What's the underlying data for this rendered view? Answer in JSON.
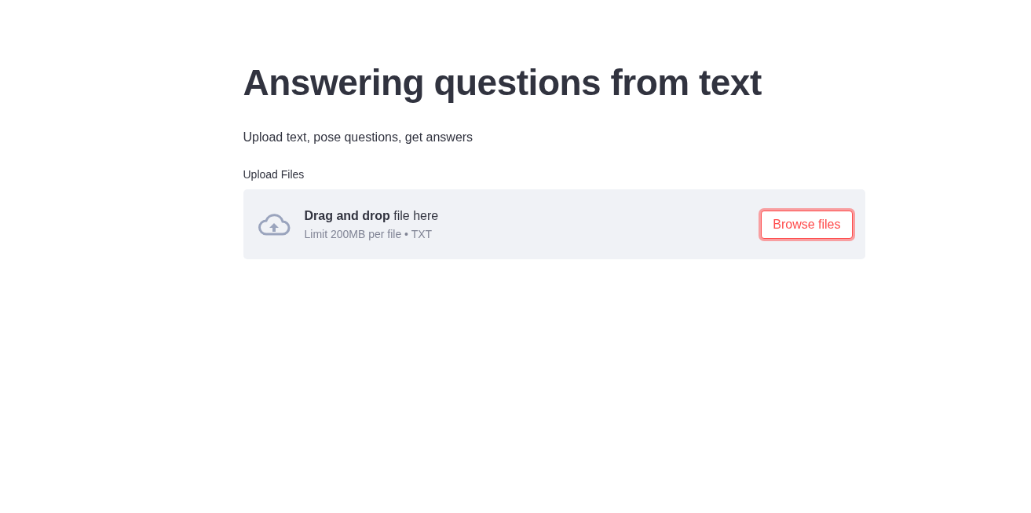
{
  "title": "Answering questions from text",
  "subtitle": "Upload text, pose questions, get answers",
  "uploader": {
    "label": "Upload Files",
    "instruction": "**Drag and drop** file here",
    "limit": "Limit 200MB per file • TXT",
    "button": {
      "label": "Browse files",
      "focused": true
    }
  }
}
